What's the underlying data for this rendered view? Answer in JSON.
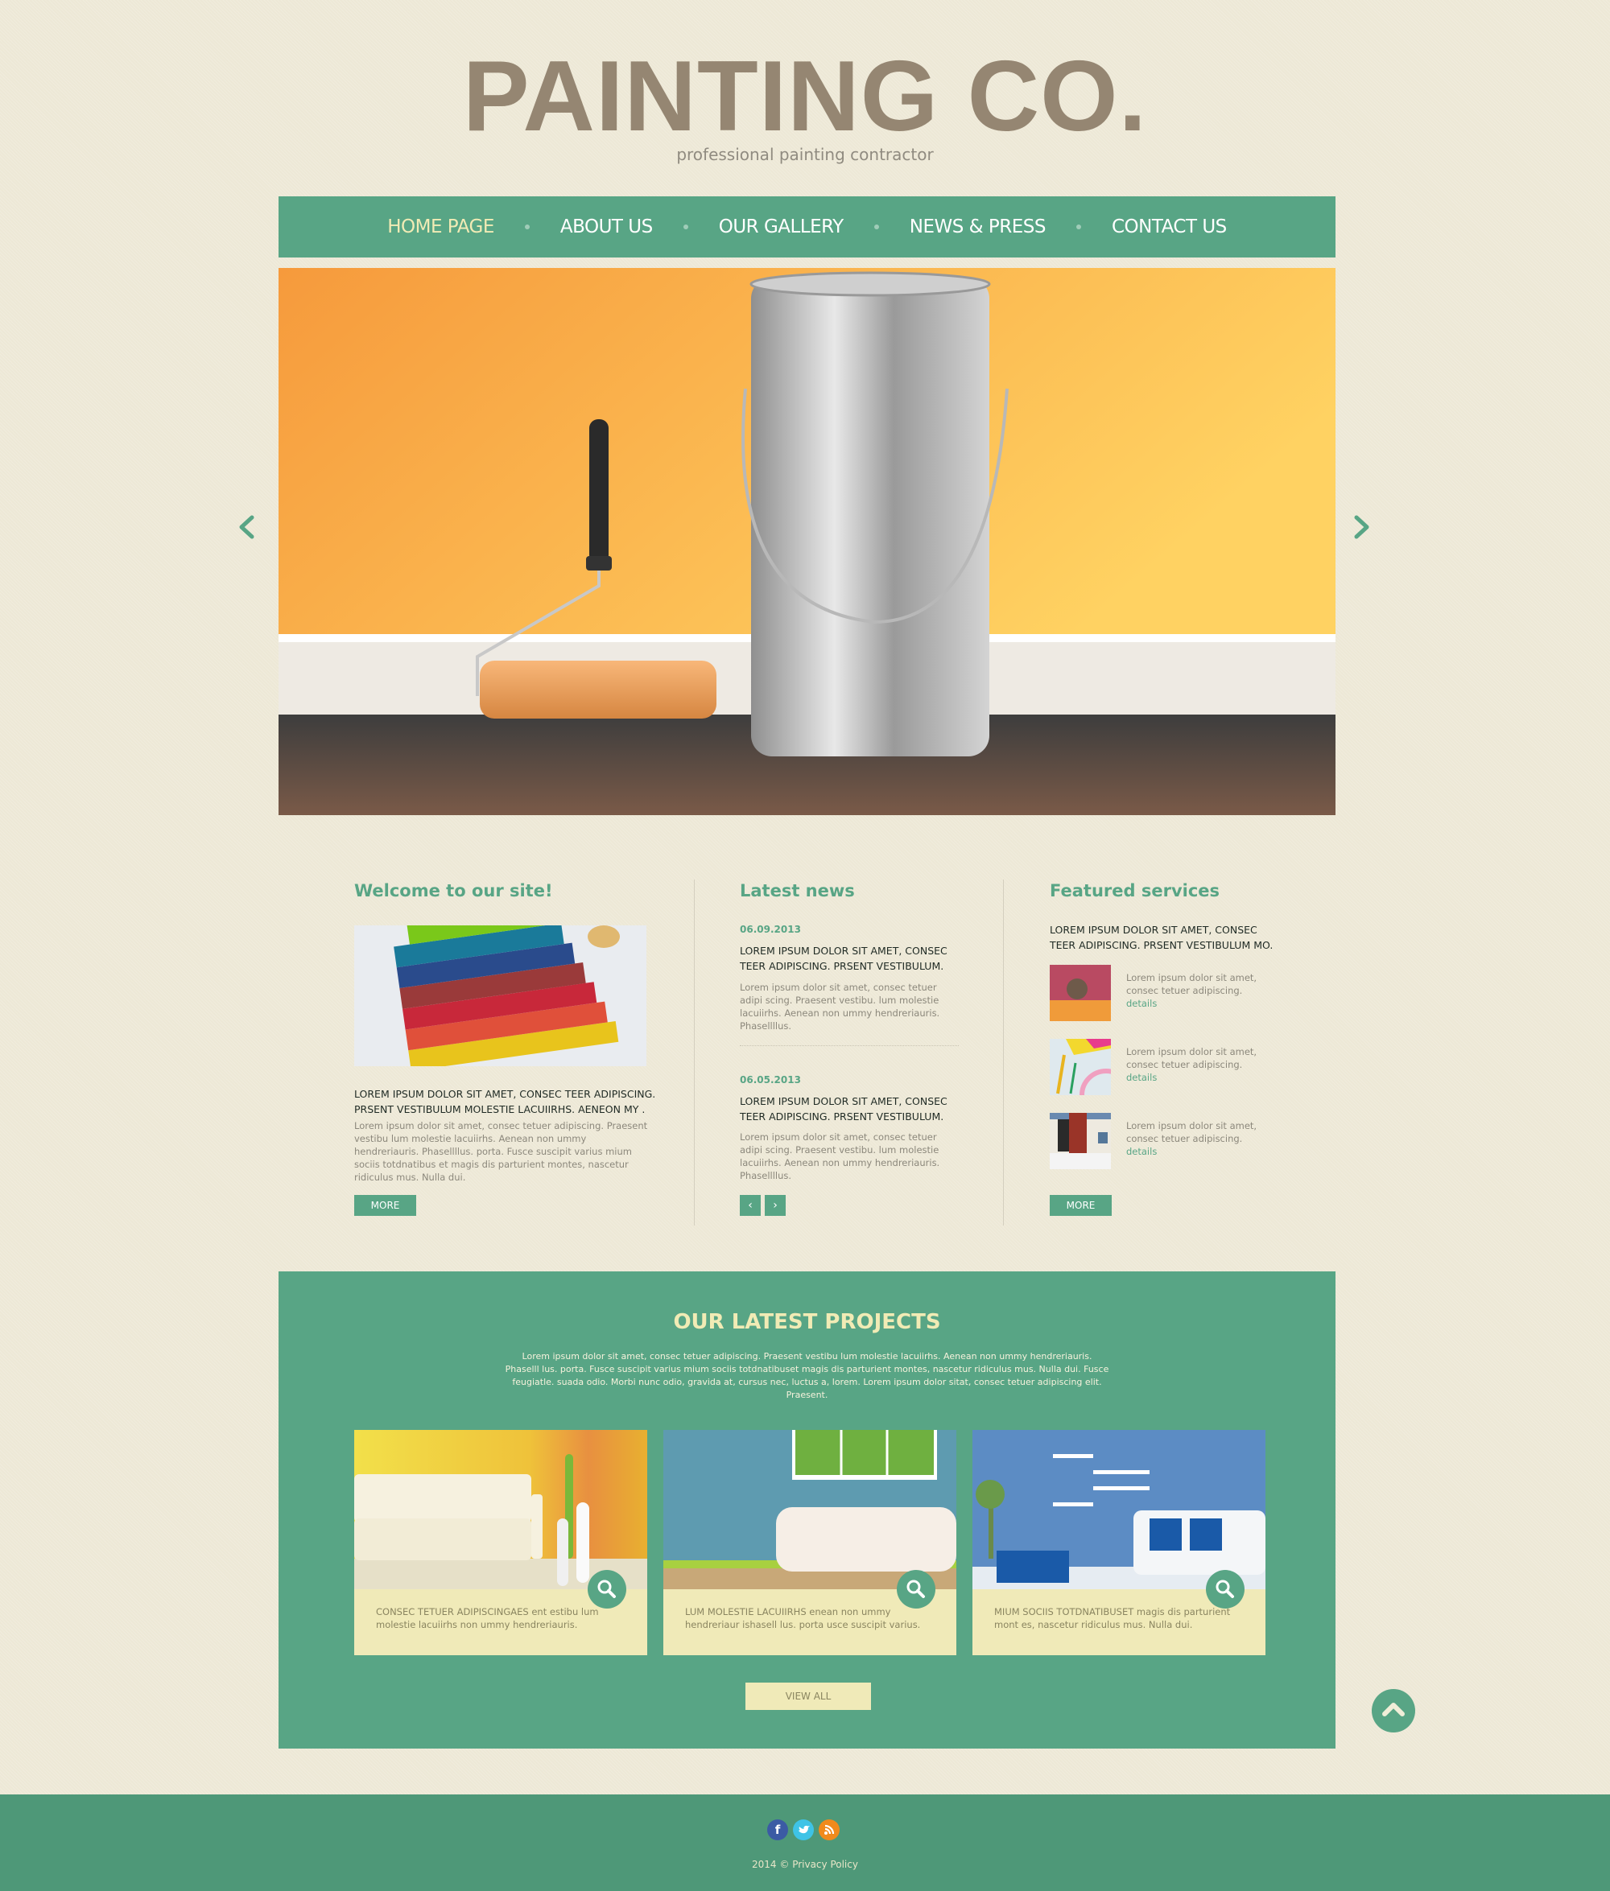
{
  "header": {
    "logo": "PAINTING CO.",
    "tagline": "professional painting contractor"
  },
  "nav": {
    "items": [
      {
        "label": "HOME PAGE",
        "active": true
      },
      {
        "label": "ABOUT US",
        "active": false
      },
      {
        "label": "OUR GALLERY",
        "active": false
      },
      {
        "label": "NEWS & PRESS",
        "active": false
      },
      {
        "label": "CONTACT US",
        "active": false
      }
    ]
  },
  "slider": {
    "prev_icon": "chevron-left-icon",
    "next_icon": "chevron-right-icon",
    "prev_glyph": "‹",
    "next_glyph": "›",
    "image_subject": "paint roller and silver paint can against orange wall"
  },
  "welcome": {
    "title": "Welcome  to our site!",
    "headline": "LOREM IPSUM DOLOR SIT AMET, CONSEC TEER ADIPISCING. PRSENT VESTIBULUM MOLESTIE LACUIIRHS. AENEON MY .",
    "body": "Lorem ipsum dolor sit amet, consec tetuer adipiscing. Praesent vestibu lum molestie lacuiirhs. Aenean non ummy hendreriauris. Phasellllus. porta. Fusce suscipit varius mium sociis totdnatibus et magis dis parturient montes, nascetur ridiculus mus. Nulla dui.",
    "more_label": "MORE"
  },
  "news": {
    "title": "Latest news",
    "items": [
      {
        "date": "06.09.2013",
        "headline": "LOREM IPSUM DOLOR SIT AMET, CONSEC TEER ADIPISCING. PRSENT VESTIBULUM.",
        "body": "Lorem ipsum dolor sit amet, consec tetuer adipi scing. Praesent vestibu.  lum molestie lacuiirhs. Aenean non ummy hendreriauris. Phasellllus."
      },
      {
        "date": "06.05.2013",
        "headline": "LOREM IPSUM DOLOR SIT AMET, CONSEC TEER ADIPISCING. PRSENT VESTIBULUM.",
        "body": "Lorem ipsum dolor sit amet, consec tetuer adipi scing. Praesent vestibu.  lum molestie lacuiirhs. Aenean non ummy hendreriauris. Phasellllus."
      }
    ],
    "prev_glyph": "‹",
    "next_glyph": "›"
  },
  "services": {
    "title": "Featured services",
    "headline": "LOREM IPSUM DOLOR SIT AMET, CONSEC TEER ADIPISCING. PRSENT VESTIBULUM MO.",
    "items": [
      {
        "text": "Lorem ipsum dolor sit amet, consec tetuer adipiscing.",
        "link": "details"
      },
      {
        "text": "Lorem ipsum dolor sit amet, consec tetuer adipiscing.",
        "link": "details"
      },
      {
        "text": "Lorem ipsum dolor sit amet, consec tetuer adipiscing.",
        "link": "details"
      }
    ],
    "more_label": "MORE"
  },
  "projects": {
    "title": "OUR LATEST PROJECTS",
    "description": "Lorem ipsum dolor sit amet, consec tetuer adipiscing. Praesent vestibu lum molestie lacuiirhs. Aenean non ummy hendreriauris. Phaselll lus. porta. Fusce suscipit varius mium sociis totdnatibuset magis dis parturient montes, nascetur ridiculus mus. Nulla dui. Fusce feugiatle. suada odio. Morbi nunc odio, gravida at, cursus nec, luctus a, lorem. Lorem ipsum dolor sitat, consec tetuer adipiscing elit. Praesent.",
    "cards": [
      {
        "caps": "CONSEC TETUER ADIPISCINGAES",
        "text": " ent estibu lum molestie lacuiirhs non ummy hendreriauris."
      },
      {
        "caps": "LUM MOLESTIE LACUIIRHS",
        "text": " enean non ummy hendreriaur ishasell lus. porta usce suscipit varius."
      },
      {
        "caps": "MIUM SOCIIS TOTDNATIBUSET",
        "text": " magis dis parturient mont es, nascetur ridiculus mus. Nulla dui."
      }
    ],
    "view_all_label": "VIEW ALL"
  },
  "footer": {
    "social": [
      {
        "name": "facebook",
        "glyph": "f",
        "color": "#3b5ba4"
      },
      {
        "name": "twitter",
        "glyph": "t",
        "color": "#3ec3e6"
      },
      {
        "name": "rss",
        "glyph": "◔",
        "color": "#f08a1c"
      }
    ],
    "copyright_prefix": "2014 © ",
    "privacy_label": "Privacy Policy"
  },
  "colors": {
    "accent": "#58a585",
    "background": "#ede8d6",
    "cream": "#f0eab8",
    "logo": "#958672"
  }
}
